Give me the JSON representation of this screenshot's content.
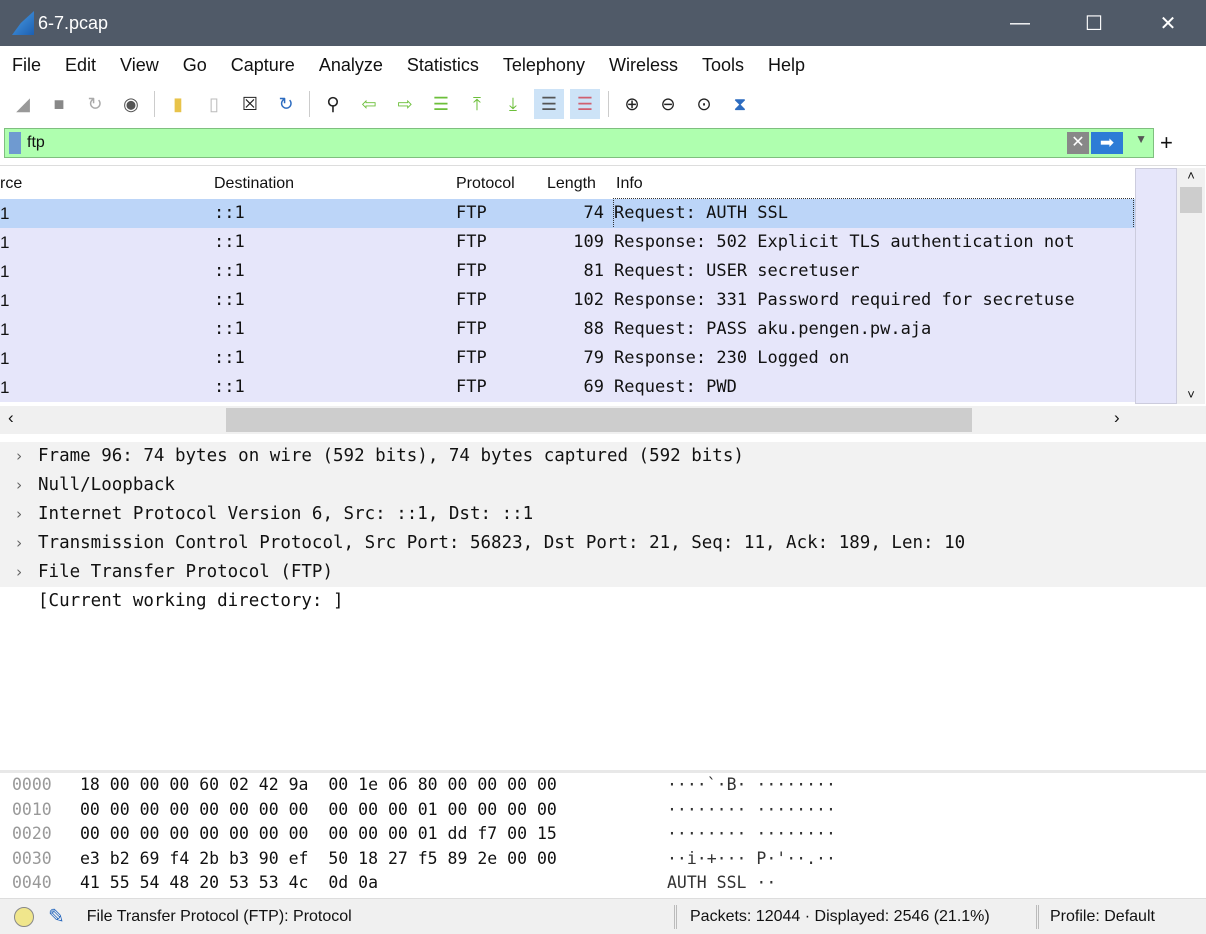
{
  "window": {
    "title": "6-7.pcap",
    "controls": {
      "minimize": "—",
      "maximize": "☐",
      "close": "✕"
    }
  },
  "menu": [
    "File",
    "Edit",
    "View",
    "Go",
    "Capture",
    "Analyze",
    "Statistics",
    "Telephony",
    "Wireless",
    "Tools",
    "Help"
  ],
  "filter": {
    "value": "ftp",
    "add_label": "+"
  },
  "columns": {
    "source": "rce",
    "destination": "Destination",
    "protocol": "Protocol",
    "length": "Length",
    "info": "Info"
  },
  "packets": [
    {
      "source": "1",
      "destination": "::1",
      "protocol": "FTP",
      "length": "74",
      "info": "Request: AUTH SSL",
      "selected": true
    },
    {
      "source": "1",
      "destination": "::1",
      "protocol": "FTP",
      "length": "109",
      "info": "Response: 502 Explicit TLS authentication not"
    },
    {
      "source": "1",
      "destination": "::1",
      "protocol": "FTP",
      "length": "81",
      "info": "Request: USER secretuser"
    },
    {
      "source": "1",
      "destination": "::1",
      "protocol": "FTP",
      "length": "102",
      "info": "Response: 331 Password required for secretuse"
    },
    {
      "source": "1",
      "destination": "::1",
      "protocol": "FTP",
      "length": "88",
      "info": "Request: PASS aku.pengen.pw.aja"
    },
    {
      "source": "1",
      "destination": "::1",
      "protocol": "FTP",
      "length": "79",
      "info": "Response: 230 Logged on"
    },
    {
      "source": "1",
      "destination": "::1",
      "protocol": "FTP",
      "length": "69",
      "info": "Request: PWD"
    }
  ],
  "details": [
    {
      "text": "Frame 96: 74 bytes on wire (592 bits), 74 bytes captured (592 bits)",
      "expandable": true
    },
    {
      "text": "Null/Loopback",
      "expandable": true
    },
    {
      "text": "Internet Protocol Version 6, Src: ::1, Dst: ::1",
      "expandable": true
    },
    {
      "text": "Transmission Control Protocol, Src Port: 56823, Dst Port: 21, Seq: 11, Ack: 189, Len: 10",
      "expandable": true
    },
    {
      "text": "File Transfer Protocol (FTP)",
      "expandable": true
    },
    {
      "text": "[Current working directory: ]",
      "expandable": false
    }
  ],
  "bytes": [
    {
      "offset": "0000",
      "hex": "18 00 00 00 60 02 42 9a  00 1e 06 80 00 00 00 00",
      "ascii": "····`·B· ········"
    },
    {
      "offset": "0010",
      "hex": "00 00 00 00 00 00 00 00  00 00 00 01 00 00 00 00",
      "ascii": "········ ········"
    },
    {
      "offset": "0020",
      "hex": "00 00 00 00 00 00 00 00  00 00 00 01 dd f7 00 15",
      "ascii": "········ ········"
    },
    {
      "offset": "0030",
      "hex": "e3 b2 69 f4 2b b3 90 ef  50 18 27 f5 89 2e 00 00",
      "ascii": "··i·+··· P·'··.··"
    },
    {
      "offset": "0040",
      "hex": "41 55 54 48 20 53 53 4c  0d 0a",
      "ascii": "AUTH SSL ··"
    }
  ],
  "status": {
    "field": "File Transfer Protocol (FTP): Protocol",
    "packets": "Packets: 12044 · Displayed: 2546 (21.1%)",
    "profile": "Profile: Default"
  },
  "scroll": {
    "left": "‹",
    "right": "›",
    "up": "˄",
    "down": "˅"
  }
}
